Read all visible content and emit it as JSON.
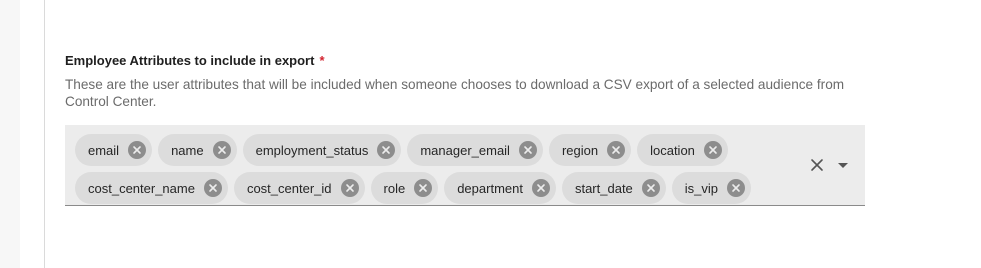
{
  "field": {
    "label": "Employee Attributes to include in export",
    "required_marker": "*",
    "help_text": "These are the user attributes that will be included when someone chooses to download a CSV export of a selected audience from Control Center."
  },
  "chips": {
    "row1": [
      "email",
      "name",
      "employment_status",
      "manager_email",
      "region",
      "location"
    ],
    "row2": [
      "cost_center_name",
      "cost_center_id",
      "role",
      "department",
      "start_date",
      "is_vip"
    ]
  },
  "icons": {
    "chip_remove": "close-circle-icon",
    "clear_all": "close-icon",
    "dropdown": "caret-down-icon"
  },
  "colors": {
    "required": "#d3232f",
    "chip_bg": "#dcdcdc",
    "field_bg": "#ececec"
  }
}
